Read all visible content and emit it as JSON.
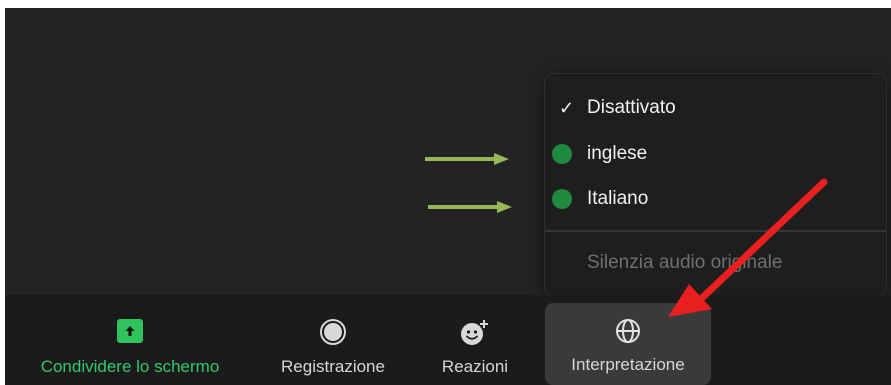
{
  "menu": {
    "items": [
      {
        "label": "Disattivato",
        "checked": true,
        "marker": "checkmark-icon"
      },
      {
        "label": "inglese",
        "marker": "green-dot",
        "color": "#1f8a3f"
      },
      {
        "label": "Italiano",
        "marker": "green-dot",
        "color": "#1f8a3f"
      }
    ],
    "mute_label": "Silenzia audio originale"
  },
  "toolbar": {
    "share_label": "Condividere lo schermo",
    "record_label": "Registrazione",
    "reactions_label": "Reazioni",
    "interpretation_label": "Interpretazione"
  },
  "colors": {
    "share_green": "#31c86b",
    "annotation_arrow_green": "#96b65a",
    "annotation_arrow_red": "#ea1f1f"
  }
}
